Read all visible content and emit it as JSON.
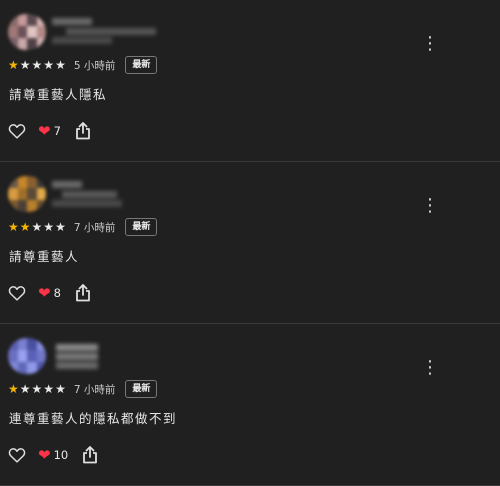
{
  "reviews": [
    {
      "rating": 1,
      "time": "5 小時前",
      "badge": "最新",
      "text": "請尊重藝人隱私",
      "reaction_count": "7",
      "avatar_colors": [
        "#8a6a6a",
        "#c59a9a",
        "#5a4a50",
        "#d8b5b0",
        "#a07878",
        "#6a5058",
        "#e0c4c0",
        "#b08a88",
        "#7a6068",
        "#c8a8a8",
        "#504048",
        "#d0b0b0"
      ]
    },
    {
      "rating": 2,
      "time": "7 小時前",
      "badge": "最新",
      "text": "請尊重藝人",
      "reaction_count": "8",
      "avatar_colors": [
        "#6a5a48",
        "#c8862a",
        "#8a6030",
        "#3a3a3a",
        "#d89a40",
        "#a07028",
        "#5a4a38",
        "#e0a848",
        "#7a5a30",
        "#4a4038",
        "#b8802a",
        "#6a5030"
      ]
    },
    {
      "rating": 1,
      "time": "7 小時前",
      "badge": "最新",
      "text": "連尊重藝人的隱私都做不到",
      "reaction_count": "10",
      "avatar_colors": [
        "#5a60b0",
        "#7a80d0",
        "#4a50a0",
        "#8a90e0",
        "#6a70c0",
        "#9aa0f0",
        "#5a60b8",
        "#7078c8",
        "#8088d8",
        "#6068b8",
        "#9098e8",
        "#5058a8"
      ]
    }
  ],
  "icons": {
    "more": "more-vert-icon",
    "like": "heart-outline-icon",
    "reaction": "red-heart-icon",
    "share": "share-icon"
  }
}
